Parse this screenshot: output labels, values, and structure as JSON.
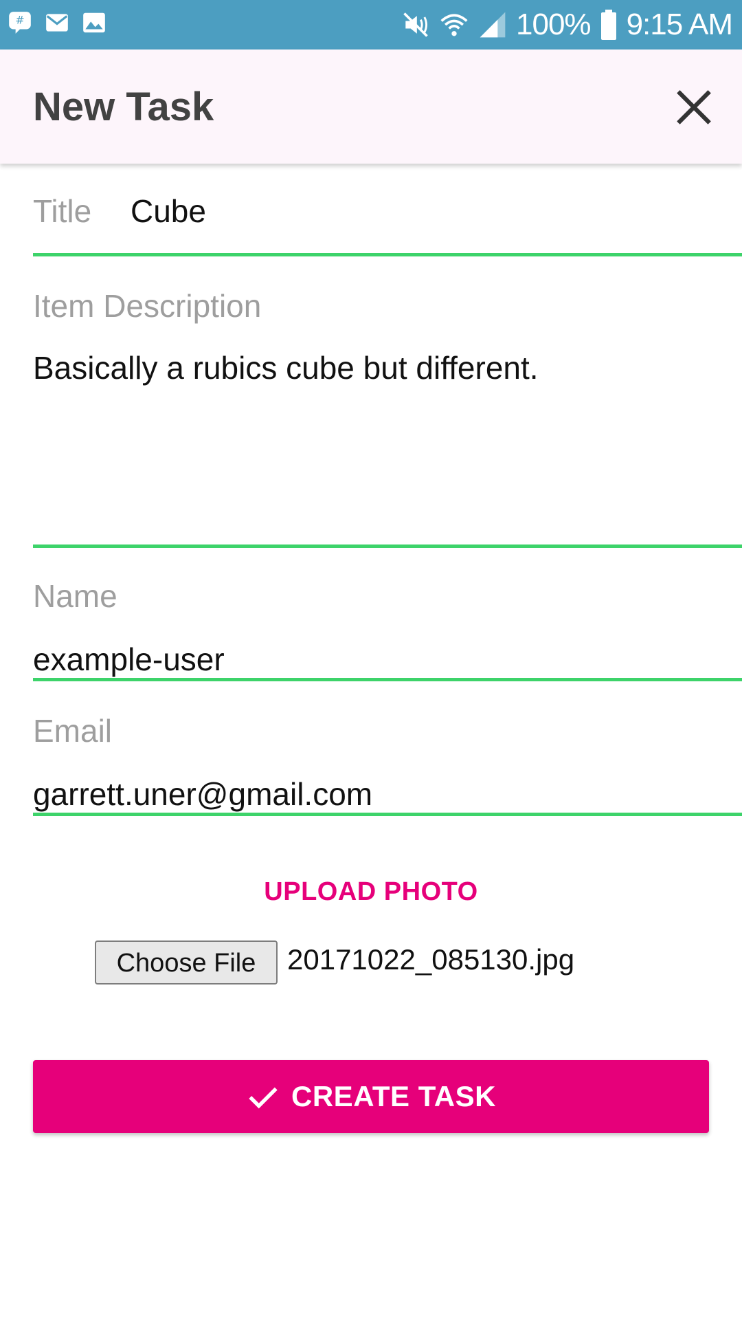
{
  "status_bar": {
    "battery": "100%",
    "time": "9:15 AM",
    "icons": [
      "groupme-icon",
      "mail-icon",
      "image-icon",
      "mute-icon",
      "wifi-icon",
      "signal-icon",
      "battery-icon"
    ]
  },
  "app_bar": {
    "title": "New Task",
    "close_icon": "close-icon"
  },
  "form": {
    "title_label": "Title",
    "title_value": "Cube",
    "description_label": "Item Description",
    "description_value": "Basically a rubics cube but different.",
    "name_label": "Name",
    "name_value": "example-user",
    "email_label": "Email",
    "email_value": "garrett.uner@gmail.com"
  },
  "upload": {
    "label": "UPLOAD PHOTO",
    "choose_button": "Choose File",
    "file_name": "20171022_085130.jpg"
  },
  "create_button": {
    "label": "CREATE TASK",
    "icon": "check-icon"
  },
  "colors": {
    "status_bar": "#4c9ec1",
    "accent": "#e6007a",
    "field_underline": "#3dd36a",
    "app_bar_bg": "#fdf5fb"
  }
}
